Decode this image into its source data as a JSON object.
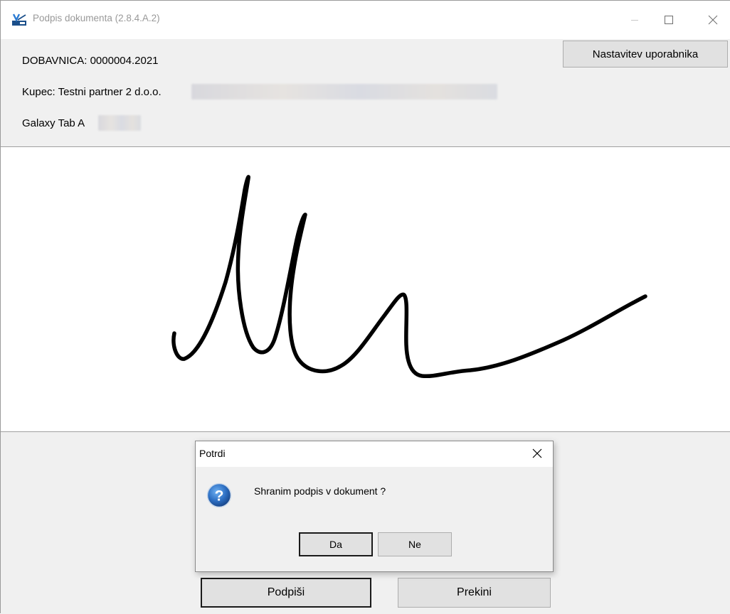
{
  "window": {
    "title": "Podpis dokumenta  (2.8.4.A.2)",
    "icon": "signature-app-icon"
  },
  "header": {
    "document_line": "DOBAVNICA: 0000004.2021",
    "customer_line": "Kupec: Testni partner 2 d.o.o.",
    "device_line": "Galaxy Tab A",
    "settings_button": "Nastavitev uporabnika"
  },
  "actions": {
    "sign_button": "Podpiši",
    "cancel_button": "Prekini"
  },
  "dialog": {
    "title": "Potrdi",
    "message": "Shranim podpis v dokument ?",
    "yes_button": "Da",
    "no_button": "Ne",
    "icon": "question-icon"
  },
  "colors": {
    "panel_bg": "#f0f0f0",
    "button_bg": "#e1e1e1",
    "signature_ink": "#000000",
    "title_gray": "#999999"
  }
}
